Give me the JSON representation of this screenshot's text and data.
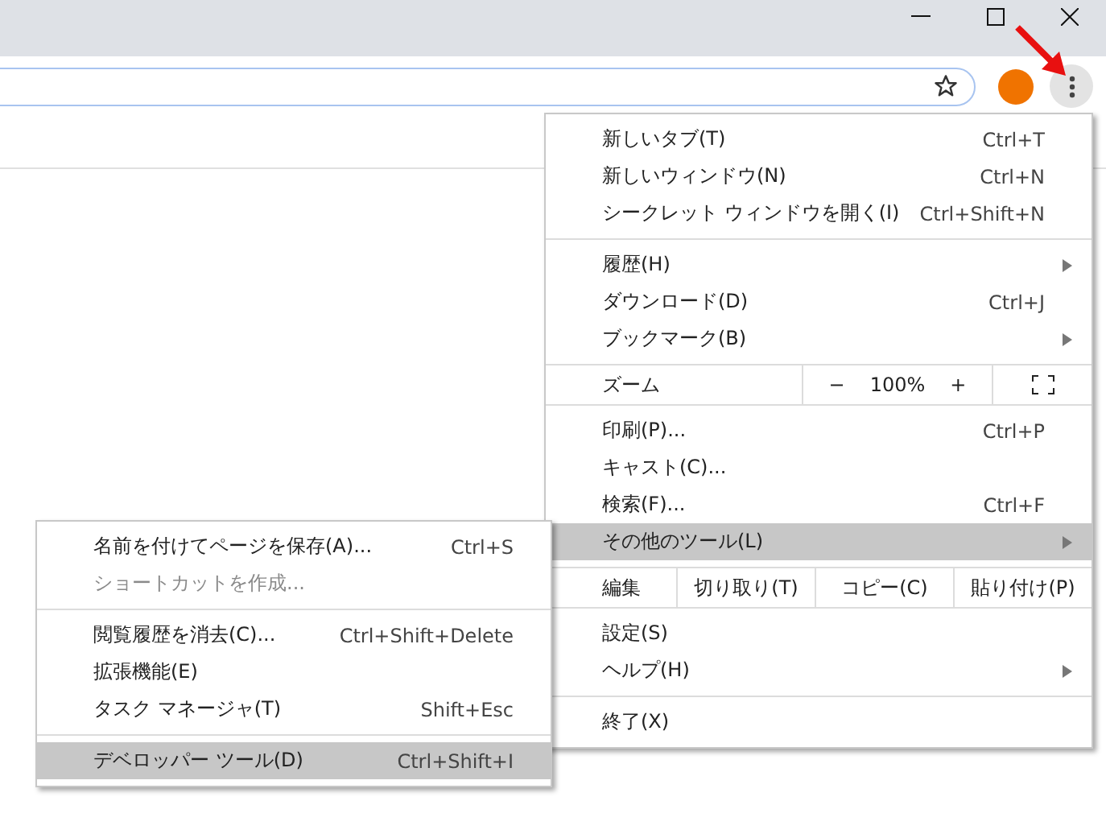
{
  "main_menu": [
    {
      "kind": "item",
      "label": "新しいタブ(T)",
      "shortcut": "Ctrl+T",
      "has_submenu": false,
      "selected": false,
      "disabled": false
    },
    {
      "kind": "item",
      "label": "新しいウィンドウ(N)",
      "shortcut": "Ctrl+N",
      "has_submenu": false,
      "selected": false,
      "disabled": false
    },
    {
      "kind": "item",
      "label": "シークレット ウィンドウを開く(I)",
      "shortcut": "Ctrl+Shift+N",
      "has_submenu": false,
      "selected": false,
      "disabled": false
    },
    {
      "kind": "separator"
    },
    {
      "kind": "item",
      "label": "履歴(H)",
      "has_submenu": true,
      "selected": false,
      "disabled": false
    },
    {
      "kind": "item",
      "label": "ダウンロード(D)",
      "shortcut": "Ctrl+J",
      "has_submenu": false,
      "selected": false,
      "disabled": false
    },
    {
      "kind": "item",
      "label": "ブックマーク(B)",
      "has_submenu": true,
      "selected": false,
      "disabled": false
    },
    {
      "kind": "zoom",
      "label": "ズーム",
      "minus": "−",
      "value": "100%",
      "plus": "+"
    },
    {
      "kind": "item",
      "label": "印刷(P)...",
      "shortcut": "Ctrl+P",
      "has_submenu": false,
      "selected": false,
      "disabled": false
    },
    {
      "kind": "item",
      "label": "キャスト(C)...",
      "has_submenu": false,
      "selected": false,
      "disabled": false
    },
    {
      "kind": "item",
      "label": "検索(F)...",
      "shortcut": "Ctrl+F",
      "has_submenu": false,
      "selected": false,
      "disabled": false
    },
    {
      "kind": "item",
      "label": "その他のツール(L)",
      "has_submenu": true,
      "selected": true,
      "disabled": false
    },
    {
      "kind": "edit",
      "label": "編集",
      "actions": [
        "切り取り(T)",
        "コピー(C)",
        "貼り付け(P)"
      ]
    },
    {
      "kind": "item",
      "label": "設定(S)",
      "has_submenu": false,
      "selected": false,
      "disabled": false
    },
    {
      "kind": "item",
      "label": "ヘルプ(H)",
      "has_submenu": true,
      "selected": false,
      "disabled": false
    },
    {
      "kind": "separator"
    },
    {
      "kind": "item",
      "label": "終了(X)",
      "has_submenu": false,
      "selected": false,
      "disabled": false
    }
  ],
  "sub_menu": [
    {
      "kind": "item",
      "label": "名前を付けてページを保存(A)...",
      "shortcut": "Ctrl+S",
      "selected": false,
      "disabled": false
    },
    {
      "kind": "item",
      "label": "ショートカットを作成...",
      "selected": false,
      "disabled": true
    },
    {
      "kind": "separator"
    },
    {
      "kind": "item",
      "label": "閲覧履歴を消去(C)...",
      "shortcut": "Ctrl+Shift+Delete",
      "selected": false,
      "disabled": false
    },
    {
      "kind": "item",
      "label": "拡張機能(E)",
      "selected": false,
      "disabled": false
    },
    {
      "kind": "item",
      "label": "タスク マネージャ(T)",
      "shortcut": "Shift+Esc",
      "selected": false,
      "disabled": false
    },
    {
      "kind": "separator"
    },
    {
      "kind": "item",
      "label": "デベロッパー ツール(D)",
      "shortcut": "Ctrl+Shift+I",
      "selected": true,
      "disabled": false
    }
  ]
}
